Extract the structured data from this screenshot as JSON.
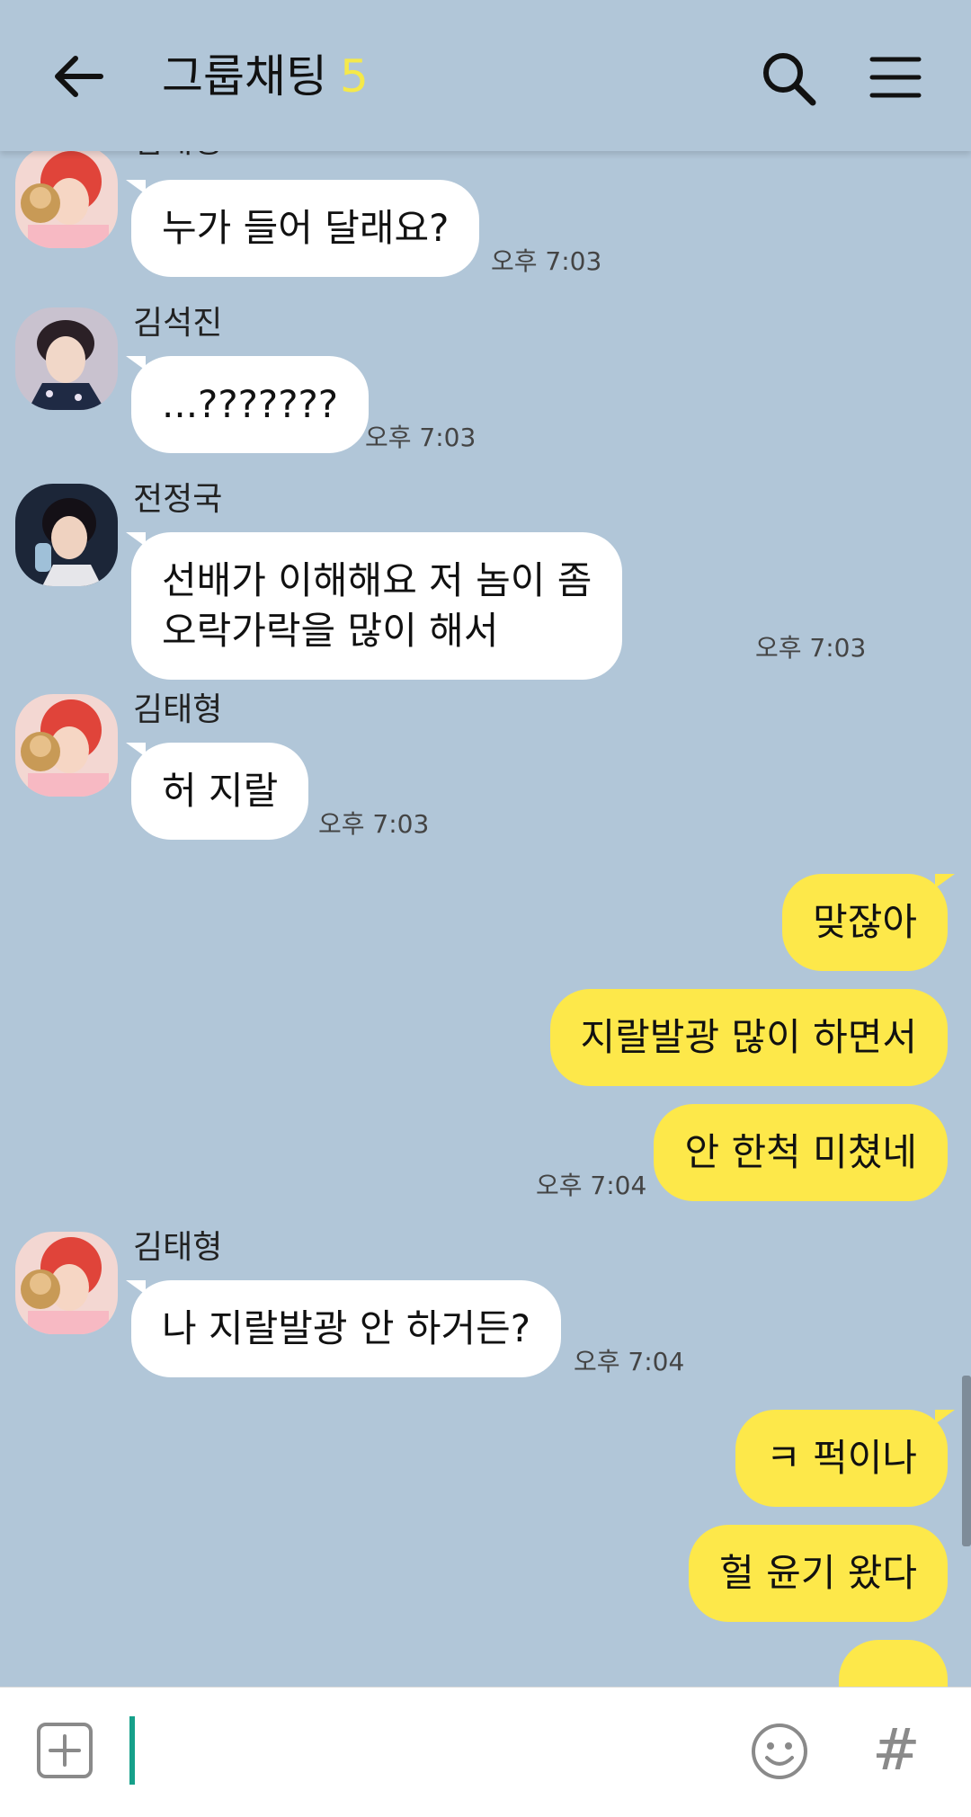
{
  "header": {
    "title": "그룹채팅",
    "member_count": "5",
    "back_icon": "back-arrow-icon",
    "search_icon": "search-icon",
    "menu_icon": "menu-icon",
    "accent_color": "#f5e94a"
  },
  "theme": {
    "background": "#b1c6d8",
    "mine_bubble": "#fde84a",
    "other_bubble": "#ffffff"
  },
  "messages": [
    {
      "sender": "김태형",
      "text": "누가 들어 달래요?",
      "time": "오후 7:03"
    },
    {
      "sender": "김석진",
      "text": "...???????",
      "time": "오후 7:03"
    },
    {
      "sender": "전정국",
      "line1": "선배가 이해해요 저 놈이 좀",
      "line2": "오락가락을 많이 해서",
      "time": "오후 7:03"
    },
    {
      "sender": "김태형",
      "text": "허 지랄",
      "time": "오후 7:03"
    },
    {
      "text": "맞잖아"
    },
    {
      "text": "지랄발광 많이 하면서"
    },
    {
      "text": "안 한척 미쳤네",
      "time": "오후 7:04"
    },
    {
      "sender": "김태형",
      "text": "나 지랄발광 안 하거든?",
      "time": "오후 7:04"
    },
    {
      "text": "ㅋ 퍽이나"
    },
    {
      "text": "헐 윤기 왔다"
    },
    {
      "text": "...."
    }
  ],
  "input": {
    "plus_icon": "add-attachment-icon",
    "emoji_icon": "emoji-icon",
    "hash_label": "#"
  }
}
